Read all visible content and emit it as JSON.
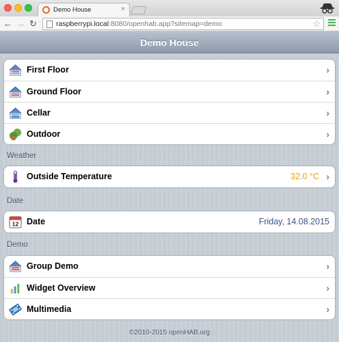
{
  "browser": {
    "tab_title": "Demo House",
    "tab_close": "×",
    "url_host": "raspberrypi.local",
    "url_rest": ":8080/openhab.app?sitemap=demo",
    "back": "←",
    "forward": "→",
    "reload": "↻",
    "star": "☆"
  },
  "header": {
    "title": "Demo House"
  },
  "main_items": [
    {
      "label": "First Floor",
      "icon": "house-icon"
    },
    {
      "label": "Ground Floor",
      "icon": "house-icon"
    },
    {
      "label": "Cellar",
      "icon": "house-icon"
    },
    {
      "label": "Outdoor",
      "icon": "garden-icon"
    }
  ],
  "sections": {
    "weather": {
      "title": "Weather",
      "items": [
        {
          "label": "Outside Temperature",
          "value": "32.0 °C",
          "value_color": "#e6a500",
          "icon": "thermometer-icon"
        }
      ]
    },
    "date": {
      "title": "Date",
      "items": [
        {
          "label": "Date",
          "value": "Friday, 14.08.2015",
          "value_color": "#385487",
          "icon": "calendar-icon",
          "calendar_day": "12"
        }
      ]
    },
    "demo": {
      "title": "Demo",
      "items": [
        {
          "label": "Group Demo",
          "icon": "house-icon"
        },
        {
          "label": "Widget Overview",
          "icon": "chart-icon"
        },
        {
          "label": "Multimedia",
          "icon": "film-icon"
        }
      ]
    }
  },
  "chevron": "›",
  "footer": "©2010-2015 openHAB.org"
}
